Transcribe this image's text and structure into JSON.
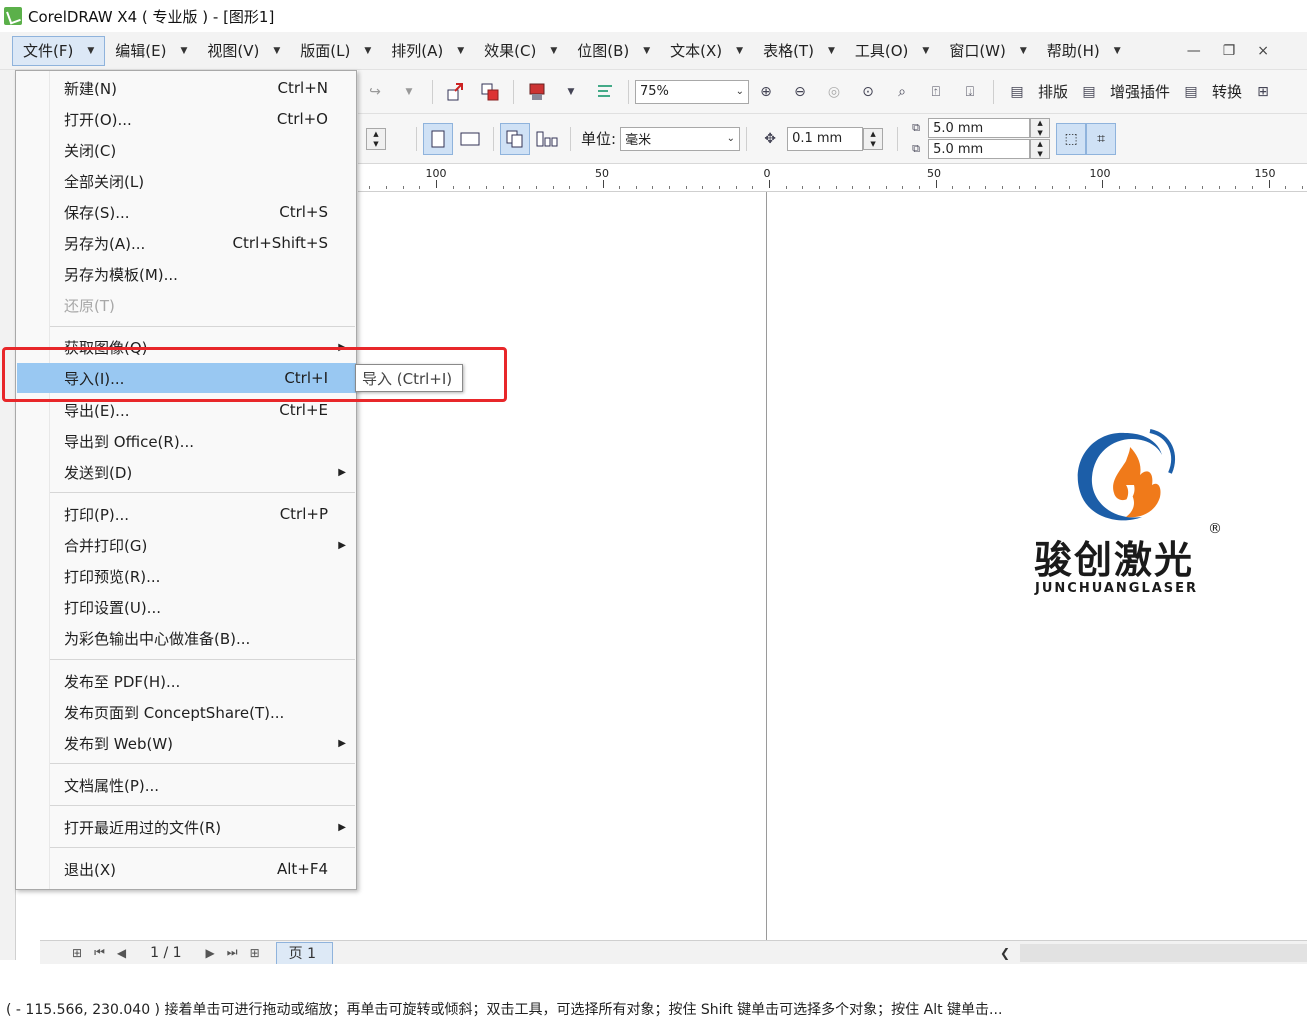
{
  "window": {
    "title": "CorelDRAW X4 ( 专业版 ) - [图形1]"
  },
  "menubar": {
    "items": [
      {
        "label": "文件(F)"
      },
      {
        "label": "编辑(E)"
      },
      {
        "label": "视图(V)"
      },
      {
        "label": "版面(L)"
      },
      {
        "label": "排列(A)"
      },
      {
        "label": "效果(C)"
      },
      {
        "label": "位图(B)"
      },
      {
        "label": "文本(X)"
      },
      {
        "label": "表格(T)"
      },
      {
        "label": "工具(O)"
      },
      {
        "label": "窗口(W)"
      },
      {
        "label": "帮助(H)"
      }
    ],
    "minimize": "—",
    "restore": "❐",
    "close": "×"
  },
  "toolbar1": {
    "zoom_value": "75%",
    "layout_label": "排版",
    "plugin_label": "增强插件",
    "convert_label": "转换"
  },
  "toolbar2": {
    "unit_label": "单位:",
    "unit_value": "毫米",
    "nudge_value": "0.1 mm",
    "dup_x": "5.0 mm",
    "dup_y": "5.0 mm"
  },
  "ruler": {
    "labels": [
      "100",
      "50",
      "0",
      "50",
      "100",
      "150"
    ]
  },
  "file_menu": {
    "items": [
      {
        "label": "新建(N)",
        "shortcut": "Ctrl+N"
      },
      {
        "label": "打开(O)...",
        "shortcut": "Ctrl+O"
      },
      {
        "label": "关闭(C)",
        "shortcut": ""
      },
      {
        "label": "全部关闭(L)",
        "shortcut": ""
      },
      {
        "label": "保存(S)...",
        "shortcut": "Ctrl+S"
      },
      {
        "label": "另存为(A)...",
        "shortcut": "Ctrl+Shift+S"
      },
      {
        "label": "另存为模板(M)...",
        "shortcut": ""
      },
      {
        "label": "还原(T)",
        "shortcut": ""
      },
      {
        "label": "获取图像(Q)",
        "shortcut": ""
      },
      {
        "label": "导入(I)...",
        "shortcut": "Ctrl+I"
      },
      {
        "label": "导出(E)...",
        "shortcut": "Ctrl+E"
      },
      {
        "label": "导出到 Office(R)...",
        "shortcut": ""
      },
      {
        "label": "发送到(D)",
        "shortcut": ""
      },
      {
        "label": "打印(P)...",
        "shortcut": "Ctrl+P"
      },
      {
        "label": "合并打印(G)",
        "shortcut": ""
      },
      {
        "label": "打印预览(R)...",
        "shortcut": ""
      },
      {
        "label": "打印设置(U)...",
        "shortcut": ""
      },
      {
        "label": "为彩色输出中心做准备(B)...",
        "shortcut": ""
      },
      {
        "label": "发布至 PDF(H)...",
        "shortcut": ""
      },
      {
        "label": "发布页面到 ConceptShare(T)...",
        "shortcut": ""
      },
      {
        "label": "发布到 Web(W)",
        "shortcut": ""
      },
      {
        "label": "文档属性(P)...",
        "shortcut": ""
      },
      {
        "label": "打开最近用过的文件(R)",
        "shortcut": ""
      },
      {
        "label": "退出(X)",
        "shortcut": "Alt+F4"
      }
    ]
  },
  "tooltip": {
    "text": "导入 (Ctrl+I)"
  },
  "logo": {
    "brand_cn": "骏创激光",
    "brand_en": "JUNCHUANGLASER",
    "registered": "®"
  },
  "pagenav": {
    "page_count": "1 / 1",
    "page_tab": "页 1"
  },
  "statusbar": {
    "text": "( - 115.566, 230.040 )  接着单击可进行拖动或缩放；再单击可旋转或倾斜；双击工具，可选择所有对象；按住 Shift 键单击可选择多个对象；按住 Alt 键单击..."
  },
  "colors": {
    "highlight": "#99c8f2",
    "annotation_red": "#e8272a",
    "app_icon": "#5bb04a",
    "logo_blue": "#1c5ea8",
    "logo_orange": "#f07a1a"
  }
}
